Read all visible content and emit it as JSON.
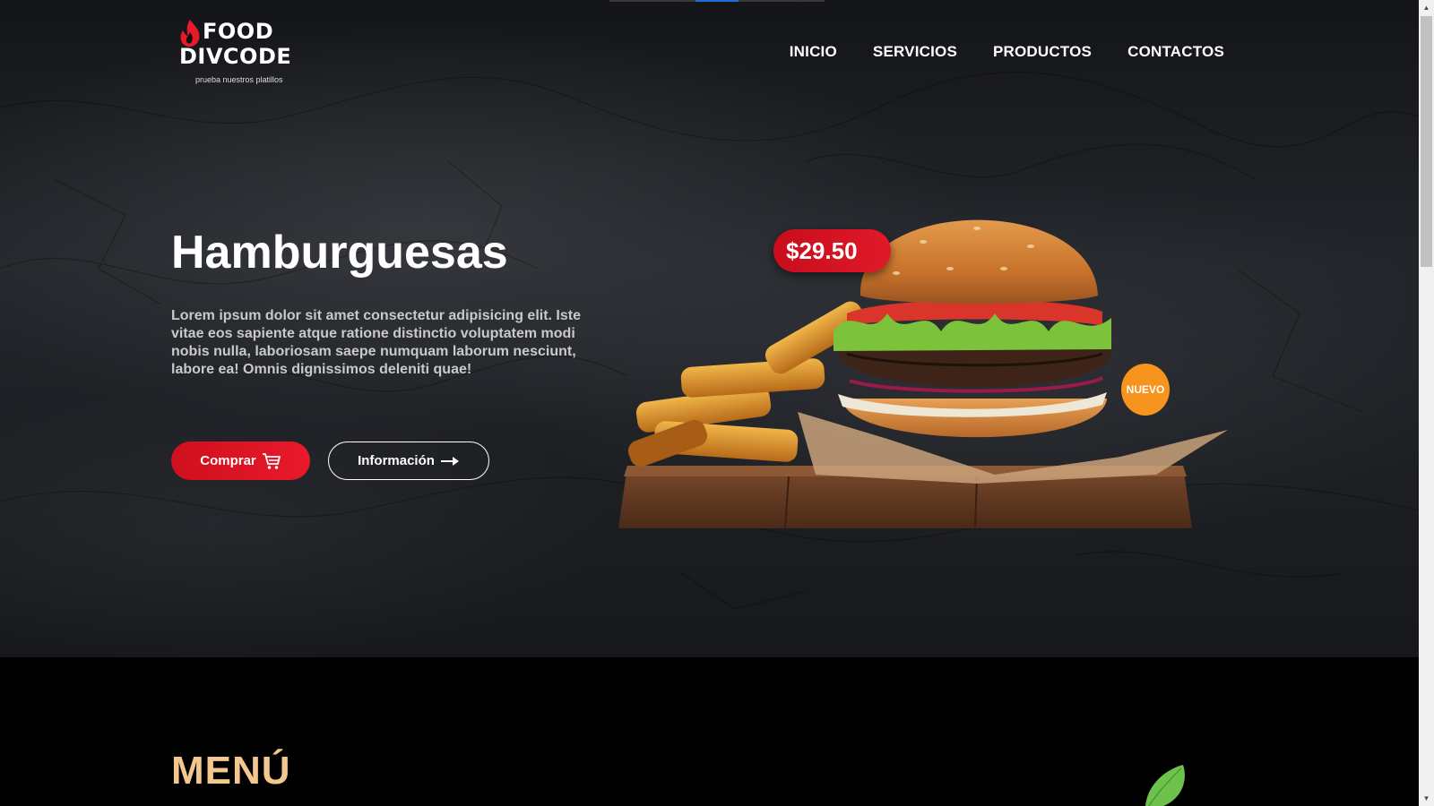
{
  "brand": {
    "line1": "FOOD",
    "line2": "DIVCODE",
    "tagline": "prueba nuestros platillos",
    "accent": "#e8192a"
  },
  "nav": {
    "items": [
      {
        "label": "INICIO"
      },
      {
        "label": "SERVICIOS"
      },
      {
        "label": "PRODUCTOS"
      },
      {
        "label": "CONTACTOS"
      }
    ]
  },
  "hero": {
    "title": "Hamburguesas",
    "description": "Lorem ipsum dolor sit amet consectetur adipisicing elit. Iste vitae eos sapiente atque ratione distinctio voluptatem modi nobis nulla, laboriosam saepe numquam laborum nesciunt, labore ea! Omnis dignissimos deleniti quae!",
    "buy_label": "Comprar",
    "buy_icon": "cart-icon",
    "info_label": "Información",
    "info_icon": "arrow-right-icon",
    "price": "$29.50",
    "badge": "NUEVO",
    "price_color": "#d0101e",
    "badge_color": "#f7941d"
  },
  "menu": {
    "title": "MENÚ",
    "title_color": "#f4c78f"
  }
}
